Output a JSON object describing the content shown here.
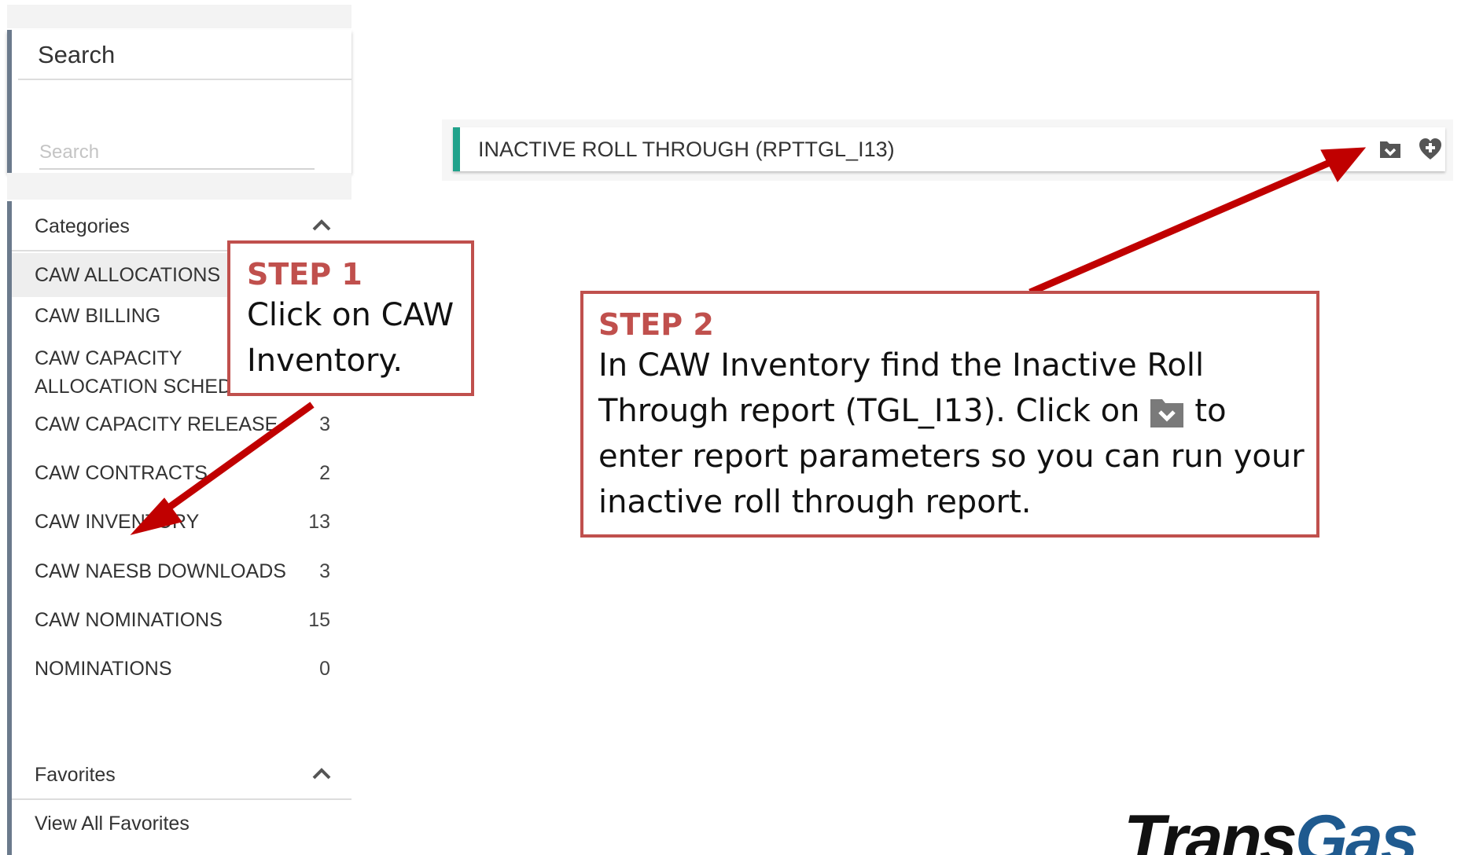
{
  "search": {
    "title": "Search",
    "placeholder": "Search"
  },
  "categories": {
    "title": "Categories",
    "items": [
      {
        "label": "CAW ALLOCATIONS",
        "count": ""
      },
      {
        "label": "CAW BILLING",
        "count": ""
      },
      {
        "label": "CAW CAPACITY ALLOCATION SCHEDULING",
        "label_line1": "CAW CAPACITY",
        "label_line2": "ALLOCATION SCHEDULING",
        "count": ""
      },
      {
        "label": "CAW CAPACITY RELEASE",
        "count": "3"
      },
      {
        "label": "CAW CONTRACTS",
        "count": "2"
      },
      {
        "label": "CAW INVENTORY",
        "count": "13"
      },
      {
        "label": "CAW NAESB DOWNLOADS",
        "count": "3"
      },
      {
        "label": "CAW NOMINATIONS",
        "count": "15"
      },
      {
        "label": "NOMINATIONS",
        "count": "0"
      }
    ]
  },
  "favorites": {
    "title": "Favorites",
    "view_all": "View All Favorites"
  },
  "report": {
    "title": "INACTIVE ROLL THROUGH (RPTTGL_I13)",
    "run_icon": "folder-check-icon",
    "favorite_icon": "heart-plus-icon"
  },
  "callouts": {
    "step1": {
      "heading": "STEP 1",
      "line1": "Click on CAW",
      "line2": "Inventory."
    },
    "step2": {
      "heading": "STEP 2",
      "line1": "In CAW Inventory find the Inactive Roll",
      "line2a": "Through report (TGL_I13). Click on",
      "line2b": "to",
      "line3": "enter report parameters so you can run your",
      "line4": "inactive roll through report."
    }
  },
  "logo": {
    "part1": "Trans",
    "part2": "Gas"
  },
  "colors": {
    "accent_teal": "#21a28b",
    "callout_red": "#c0504d",
    "arrow_red": "#c00000",
    "sidebar_border": "#6b7a8c"
  }
}
